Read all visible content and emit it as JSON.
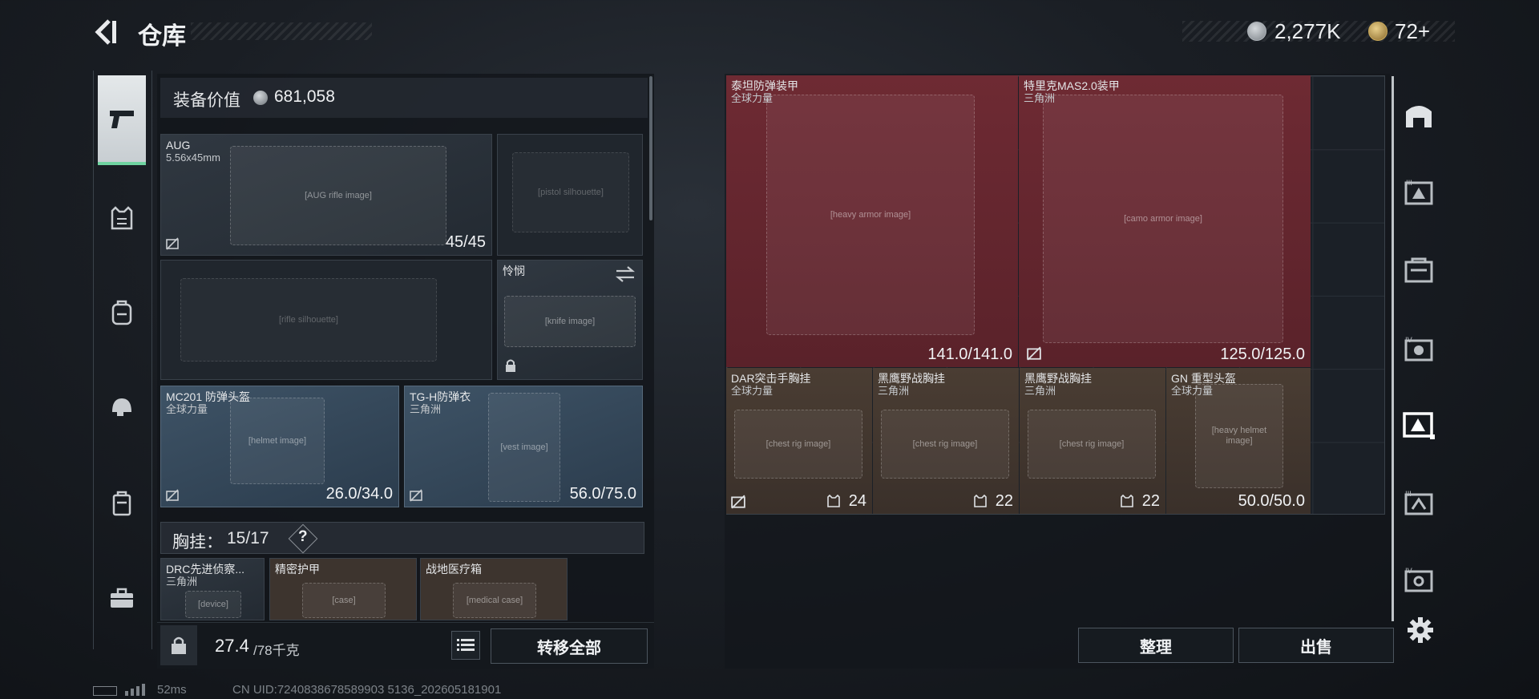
{
  "header": {
    "title": "仓库",
    "currency_value": "2,277K",
    "secondary_value": "72+"
  },
  "left_tabs": [
    {
      "icon": "pistol-icon",
      "active": true
    },
    {
      "icon": "vest-icon"
    },
    {
      "icon": "backpack-icon"
    },
    {
      "icon": "helmet-icon"
    },
    {
      "icon": "case-icon"
    },
    {
      "icon": "toolbox-icon"
    }
  ],
  "loadout": {
    "value_label": "装备价值",
    "value": "681,058",
    "primary_weapon": {
      "name": "AUG",
      "caliber": "5.56x45mm",
      "durability": "45/45"
    },
    "melee": {
      "name": "怜悯"
    },
    "helmet": {
      "name": "MC201 防弹头盔",
      "faction": "全球力量",
      "durability": "26.0/34.0"
    },
    "armor": {
      "name": "TG-H防弹衣",
      "faction": "三角洲",
      "durability": "56.0/75.0"
    },
    "chest_rig": {
      "label": "胸挂：",
      "capacity": "15/17",
      "help": "?"
    },
    "rig_items": [
      {
        "name": "DRC先进侦察...",
        "faction": "三角洲"
      },
      {
        "name": "精密护甲"
      },
      {
        "name": "战地医疗箱"
      }
    ],
    "weight": {
      "current": "27.4",
      "max": "/78千克"
    },
    "transfer_all_label": "转移全部"
  },
  "storage": {
    "items": [
      {
        "name": "泰坦防弹装甲",
        "faction": "全球力量",
        "durability": "141.0/141.0"
      },
      {
        "name": "特里克MAS2.0装甲",
        "faction": "三角洲",
        "durability": "125.0/125.0"
      },
      {
        "name": "DAR突击手胸挂",
        "faction": "全球力量",
        "count": "24"
      },
      {
        "name": "黑鹰野战胸挂",
        "faction": "三角洲",
        "count": "22"
      },
      {
        "name": "黑鹰野战胸挂",
        "faction": "三角洲",
        "count": "22"
      },
      {
        "name": "GN 重型头盔",
        "faction": "全球力量",
        "durability": "50.0/50.0"
      }
    ],
    "sort_label": "整理",
    "sell_label": "出售"
  },
  "right_tabs": [
    "floor-icon",
    "tier-3-case-icon",
    "storage-case-icon",
    "tier-4-case-icon",
    "selected-case-icon",
    "tier-3-small-case-icon",
    "tier-4-small-case-icon"
  ],
  "status_bar": {
    "ping": "52ms",
    "uid": "CN UID:7240838678589903 5136_202605181901"
  },
  "colors": {
    "accent_green": "#6fd3a0",
    "storage_red": "#6e2a33",
    "storage_brown": "#4a3d33",
    "helmet_blue": "#3e5366"
  }
}
